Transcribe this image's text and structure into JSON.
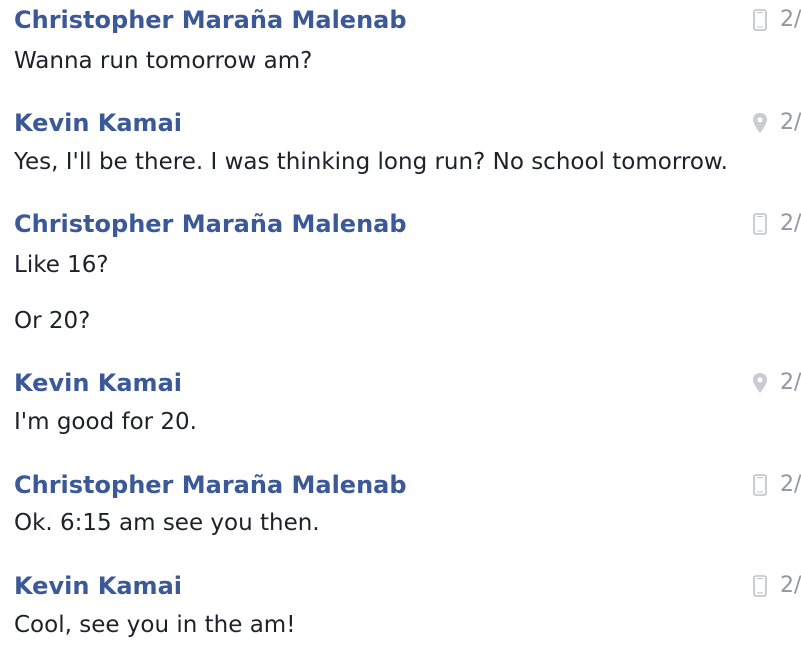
{
  "conversation": {
    "groups": [
      {
        "sender": "Christopher Maraña Malenab",
        "source_icon": "mobile-phone-icon",
        "time": "2/",
        "messages": [
          "Wanna run tomorrow am?"
        ]
      },
      {
        "sender": "Kevin Kamai",
        "source_icon": "location-pin-icon",
        "time": "2/",
        "messages": [
          "Yes, I'll be there. I was thinking long run? No school tomorrow."
        ]
      },
      {
        "sender": "Christopher Maraña Malenab",
        "source_icon": "mobile-phone-icon",
        "time": "2/",
        "messages": [
          "Like 16?",
          "Or 20?"
        ]
      },
      {
        "sender": "Kevin Kamai",
        "source_icon": "location-pin-icon",
        "time": "2/",
        "messages": [
          "I'm good for 20."
        ]
      },
      {
        "sender": "Christopher Maraña Malenab",
        "source_icon": "mobile-phone-icon",
        "time": "2/",
        "messages": [
          "Ok. 6:15 am see you then."
        ]
      },
      {
        "sender": "Kevin Kamai",
        "source_icon": "mobile-phone-icon",
        "time": "2/",
        "messages": [
          "Cool, see you in the am!"
        ]
      }
    ]
  }
}
